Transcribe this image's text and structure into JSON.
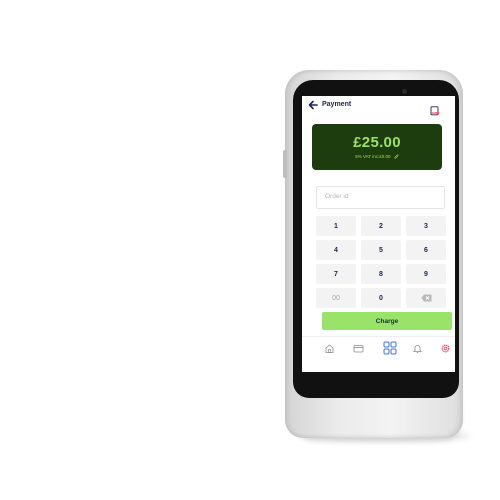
{
  "topbar": {
    "title": "Payment",
    "back_icon": "arrow-left-icon",
    "receipt_icon": "receipt-icon"
  },
  "amount_card": {
    "amount": "£25.00",
    "vat_text": "5% VAT inc:£0.00",
    "edit_icon": "pencil-icon",
    "background": "#1e3d0e",
    "text_color": "#9be265"
  },
  "order_field": {
    "placeholder": "Order id",
    "value": ""
  },
  "keypad": {
    "keys": [
      "1",
      "2",
      "3",
      "4",
      "5",
      "6",
      "7",
      "8",
      "9",
      "00",
      "0",
      "⌫"
    ]
  },
  "charge_button": {
    "label": "Charge",
    "color": "#99e468"
  },
  "bottom_nav": {
    "items": [
      "home-icon",
      "card-icon",
      "grid-icon",
      "bell-icon",
      "settings-icon"
    ],
    "active": "grid-icon"
  }
}
